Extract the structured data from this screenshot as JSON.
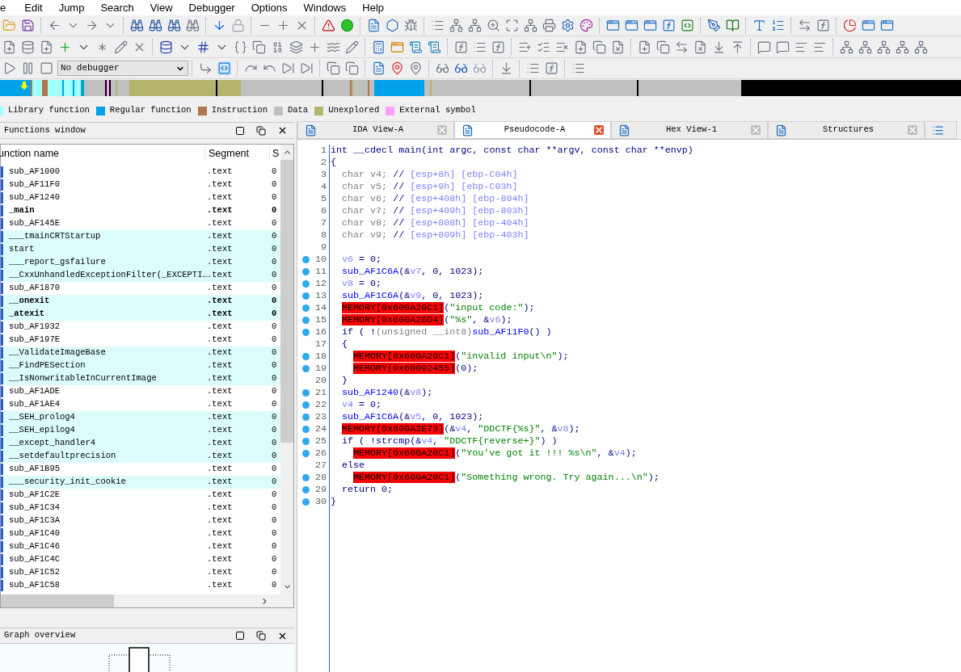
{
  "menu": [
    {
      "label": "e"
    },
    {
      "label": "Edit"
    },
    {
      "label": "Jump"
    },
    {
      "label": "Search"
    },
    {
      "label": "View"
    },
    {
      "label": "Debugger"
    },
    {
      "label": "Options"
    },
    {
      "label": "Windows"
    },
    {
      "label": "Help"
    }
  ],
  "debugger_select": {
    "value": "No debugger"
  },
  "legend": [
    {
      "label": "Library function",
      "color": "#a0ffff"
    },
    {
      "label": "Regular function",
      "color": "#00a2e8"
    },
    {
      "label": "Instruction",
      "color": "#b07850"
    },
    {
      "label": "Data",
      "color": "#c0c0c0"
    },
    {
      "label": "Unexplored",
      "color": "#b4b46c"
    },
    {
      "label": "External symbol",
      "color": "#ffa0ff"
    }
  ],
  "functions_window": {
    "title": "Functions window",
    "columns": [
      "unction name",
      "Segment",
      "S"
    ],
    "rows": [
      {
        "name": "sub_AF1000",
        "segment": ".text",
        "column_3": "0",
        "library": false,
        "bold": false
      },
      {
        "name": "sub_AF11F0",
        "segment": ".text",
        "column_3": "0",
        "library": false,
        "bold": false
      },
      {
        "name": "sub_AF1240",
        "segment": ".text",
        "column_3": "0",
        "library": false,
        "bold": false
      },
      {
        "name": "_main",
        "segment": ".text",
        "column_3": "0",
        "library": false,
        "bold": true
      },
      {
        "name": "sub_AF145E",
        "segment": ".text",
        "column_3": "0",
        "library": false,
        "bold": false
      },
      {
        "name": "___tmainCRTStartup",
        "segment": ".text",
        "column_3": "0",
        "library": true,
        "bold": false
      },
      {
        "name": "start",
        "segment": ".text",
        "column_3": "0",
        "library": true,
        "bold": false
      },
      {
        "name": "___report_gsfailure",
        "segment": ".text",
        "column_3": "0",
        "library": true,
        "bold": false
      },
      {
        "name": "__CxxUnhandledExceptionFilter(_EXCEPTI…",
        "segment": ".text",
        "column_3": "0",
        "library": true,
        "bold": false
      },
      {
        "name": "sub_AF1870",
        "segment": ".text",
        "column_3": "0",
        "library": false,
        "bold": false
      },
      {
        "name": "__onexit",
        "segment": ".text",
        "column_3": "0",
        "library": true,
        "bold": true
      },
      {
        "name": "_atexit",
        "segment": ".text",
        "column_3": "0",
        "library": true,
        "bold": true
      },
      {
        "name": "sub_AF1932",
        "segment": ".text",
        "column_3": "0",
        "library": false,
        "bold": false
      },
      {
        "name": "sub_AF197E",
        "segment": ".text",
        "column_3": "0",
        "library": false,
        "bold": false
      },
      {
        "name": "__ValidateImageBase",
        "segment": ".text",
        "column_3": "0",
        "library": true,
        "bold": false
      },
      {
        "name": "__FindPESection",
        "segment": ".text",
        "column_3": "0",
        "library": true,
        "bold": false
      },
      {
        "name": "__IsNonwritableInCurrentImage",
        "segment": ".text",
        "column_3": "0",
        "library": true,
        "bold": false
      },
      {
        "name": "sub_AF1ADE",
        "segment": ".text",
        "column_3": "0",
        "library": false,
        "bold": false
      },
      {
        "name": "sub_AF1AE4",
        "segment": ".text",
        "column_3": "0",
        "library": false,
        "bold": false
      },
      {
        "name": "__SEH_prolog4",
        "segment": ".text",
        "column_3": "0",
        "library": true,
        "bold": false
      },
      {
        "name": "__SEH_epilog4",
        "segment": ".text",
        "column_3": "0",
        "library": true,
        "bold": false
      },
      {
        "name": "__except_handler4",
        "segment": ".text",
        "column_3": "0",
        "library": true,
        "bold": false
      },
      {
        "name": "__setdefaultprecision",
        "segment": ".text",
        "column_3": "0",
        "library": true,
        "bold": false
      },
      {
        "name": "sub_AF1B95",
        "segment": ".text",
        "column_3": "0",
        "library": false,
        "bold": false
      },
      {
        "name": "___security_init_cookie",
        "segment": ".text",
        "column_3": "0",
        "library": true,
        "bold": false
      },
      {
        "name": "sub_AF1C2E",
        "segment": ".text",
        "column_3": "0",
        "library": false,
        "bold": false
      },
      {
        "name": "sub_AF1C34",
        "segment": ".text",
        "column_3": "0",
        "library": false,
        "bold": false
      },
      {
        "name": "sub_AF1C3A",
        "segment": ".text",
        "column_3": "0",
        "library": false,
        "bold": false
      },
      {
        "name": "sub_AF1C40",
        "segment": ".text",
        "column_3": "0",
        "library": false,
        "bold": false
      },
      {
        "name": "sub_AF1C46",
        "segment": ".text",
        "column_3": "0",
        "library": false,
        "bold": false
      },
      {
        "name": "sub_AF1C4C",
        "segment": ".text",
        "column_3": "0",
        "library": false,
        "bold": false
      },
      {
        "name": "sub_AF1C52",
        "segment": ".text",
        "column_3": "0",
        "library": false,
        "bold": false
      },
      {
        "name": "sub_AF1C58",
        "segment": ".text",
        "column_3": "0",
        "library": false,
        "bold": false
      }
    ]
  },
  "graph_overview": {
    "title": "Graph overview"
  },
  "tabs": [
    {
      "kind": "labeled",
      "label": "IDA View-A",
      "selected": false
    },
    {
      "kind": "labeled",
      "label": "Pseudocode-A",
      "selected": true
    },
    {
      "kind": "labeled",
      "label": "Hex View-1",
      "selected": false
    },
    {
      "kind": "labeled",
      "label": "Structures",
      "selected": false
    },
    {
      "kind": "icon-only",
      "selected": false
    }
  ],
  "code_lines": [
    {
      "n": "1",
      "dot": false,
      "tokens": [
        {
          "kind": "plain",
          "text": "int __cdecl main(int argc, const char **argv, const char **envp)"
        }
      ]
    },
    {
      "n": "2",
      "dot": false,
      "tokens": [
        {
          "kind": "plain",
          "text": "{"
        }
      ],
      "children": [
        {
          "n": "3",
          "dot": false,
          "tokens": [
            {
              "kind": "decl",
              "text": "char v4; "
            },
            {
              "kind": "plain",
              "text": "// "
            },
            {
              "kind": "var",
              "text": "[esp+8h] [ebp-C04h]"
            }
          ]
        },
        {
          "n": "4",
          "dot": false,
          "tokens": [
            {
              "kind": "decl",
              "text": "char v5; "
            },
            {
              "kind": "plain",
              "text": "// "
            },
            {
              "kind": "var",
              "text": "[esp+9h] [ebp-C03h]"
            }
          ]
        },
        {
          "n": "5",
          "dot": false,
          "tokens": [
            {
              "kind": "decl",
              "text": "char v6; "
            },
            {
              "kind": "plain",
              "text": "// "
            },
            {
              "kind": "var",
              "text": "[esp+408h] [ebp-804h]"
            }
          ]
        },
        {
          "n": "6",
          "dot": false,
          "tokens": [
            {
              "kind": "decl",
              "text": "char v7; "
            },
            {
              "kind": "plain",
              "text": "// "
            },
            {
              "kind": "var",
              "text": "[esp+409h] [ebp-803h]"
            }
          ]
        },
        {
          "n": "7",
          "dot": false,
          "tokens": [
            {
              "kind": "decl",
              "text": "char v8; "
            },
            {
              "kind": "plain",
              "text": "// "
            },
            {
              "kind": "var",
              "text": "[esp+808h] [ebp-404h]"
            }
          ]
        },
        {
          "n": "8",
          "dot": false,
          "tokens": [
            {
              "kind": "decl",
              "text": "char v9; "
            },
            {
              "kind": "plain",
              "text": "// "
            },
            {
              "kind": "var",
              "text": "[esp+809h] [ebp-403h]"
            }
          ]
        },
        {
          "n": "9",
          "dot": false
        },
        {
          "n": "10",
          "dot": true,
          "tokens": [
            {
              "kind": "var",
              "text": "v6"
            },
            {
              "kind": "plain",
              "text": " = 0;"
            }
          ]
        },
        {
          "n": "11",
          "dot": true,
          "tokens": [
            {
              "kind": "func",
              "text": "sub_AF1C6A"
            },
            {
              "kind": "plain",
              "text": "(&"
            },
            {
              "kind": "var",
              "text": "v7"
            },
            {
              "kind": "plain",
              "text": ", 0, 1023);"
            }
          ]
        },
        {
          "n": "12",
          "dot": true,
          "tokens": [
            {
              "kind": "var",
              "text": "v8"
            },
            {
              "kind": "plain",
              "text": " = 0;"
            }
          ]
        },
        {
          "n": "13",
          "dot": true,
          "tokens": [
            {
              "kind": "func",
              "text": "sub_AF1C6A"
            },
            {
              "kind": "plain",
              "text": "(&"
            },
            {
              "kind": "var",
              "text": "v9"
            },
            {
              "kind": "plain",
              "text": ", 0, 1023);"
            }
          ]
        },
        {
          "n": "14",
          "dot": true,
          "tokens": [
            {
              "kind": "mem",
              "text": "MEMORY[0x600A20C1]"
            },
            {
              "kind": "plain",
              "text": "("
            },
            {
              "kind": "str",
              "text": "\"input code:\""
            },
            {
              "kind": "plain",
              "text": ");"
            }
          ]
        },
        {
          "n": "15",
          "dot": true,
          "tokens": [
            {
              "kind": "mem",
              "text": "MEMORY[0x600A26D4]"
            },
            {
              "kind": "plain",
              "text": "("
            },
            {
              "kind": "str",
              "text": "\"%s\""
            },
            {
              "kind": "plain",
              "text": ", &"
            },
            {
              "kind": "var",
              "text": "v6"
            },
            {
              "kind": "plain",
              "text": ");"
            }
          ]
        },
        {
          "n": "16",
          "dot": true,
          "tokens": [
            {
              "kind": "plain",
              "text": "if ( !"
            },
            {
              "kind": "decl",
              "text": "(unsigned __int8)"
            },
            {
              "kind": "func",
              "text": "sub_AF11F0"
            },
            {
              "kind": "plain",
              "text": "() )"
            }
          ]
        },
        {
          "n": "17",
          "dot": false,
          "tokens": [
            {
              "kind": "plain",
              "text": "{"
            }
          ],
          "children": [
            {
              "n": "18",
              "dot": true,
              "tokens": [
                {
                  "kind": "mem",
                  "text": "MEMORY[0x600A20C1]"
                },
                {
                  "kind": "plain",
                  "text": "("
                },
                {
                  "kind": "str",
                  "text": "\"invalid input\\n\""
                },
                {
                  "kind": "plain",
                  "text": ");"
                }
              ]
            },
            {
              "n": "19",
              "dot": true,
              "tokens": [
                {
                  "kind": "mem",
                  "text": "MEMORY[0x60092455]"
                },
                {
                  "kind": "plain",
                  "text": "(0);"
                }
              ]
            }
          ]
        },
        {
          "n": "20",
          "dot": false,
          "tokens": [
            {
              "kind": "plain",
              "text": "}"
            }
          ]
        },
        {
          "n": "21",
          "dot": true,
          "tokens": [
            {
              "kind": "func",
              "text": "sub_AF1240"
            },
            {
              "kind": "plain",
              "text": "(&"
            },
            {
              "kind": "var",
              "text": "v8"
            },
            {
              "kind": "plain",
              "text": ");"
            }
          ]
        },
        {
          "n": "22",
          "dot": true,
          "tokens": [
            {
              "kind": "var",
              "text": "v4"
            },
            {
              "kind": "plain",
              "text": " = 0;"
            }
          ]
        },
        {
          "n": "23",
          "dot": true,
          "tokens": [
            {
              "kind": "func",
              "text": "sub_AF1C6A"
            },
            {
              "kind": "plain",
              "text": "(&"
            },
            {
              "kind": "var",
              "text": "v5"
            },
            {
              "kind": "plain",
              "text": ", 0, 1023);"
            }
          ]
        },
        {
          "n": "24",
          "dot": true,
          "tokens": [
            {
              "kind": "mem",
              "text": "MEMORY[0x600A2E73]"
            },
            {
              "kind": "plain",
              "text": "(&"
            },
            {
              "kind": "var",
              "text": "v4"
            },
            {
              "kind": "plain",
              "text": ", "
            },
            {
              "kind": "str",
              "text": "\"DDCTF{%s}\""
            },
            {
              "kind": "plain",
              "text": ", &"
            },
            {
              "kind": "var",
              "text": "v8"
            },
            {
              "kind": "plain",
              "text": ");"
            }
          ]
        },
        {
          "n": "25",
          "dot": true,
          "tokens": [
            {
              "kind": "plain",
              "text": "if ( !strcmp(&"
            },
            {
              "kind": "var",
              "text": "v4"
            },
            {
              "kind": "plain",
              "text": ", "
            },
            {
              "kind": "str",
              "text": "\"DDCTF{reverse+}\""
            },
            {
              "kind": "plain",
              "text": ") )"
            }
          ],
          "children": [
            {
              "n": "26",
              "dot": true,
              "tokens": [
                {
                  "kind": "mem",
                  "text": "MEMORY[0x600A20C1]"
                },
                {
                  "kind": "plain",
                  "text": "("
                },
                {
                  "kind": "str",
                  "text": "\"You've got it !!! %s\\n\""
                },
                {
                  "kind": "plain",
                  "text": ", &"
                },
                {
                  "kind": "var",
                  "text": "v4"
                },
                {
                  "kind": "plain",
                  "text": ");"
                }
              ]
            }
          ]
        },
        {
          "n": "27",
          "dot": false,
          "tokens": [
            {
              "kind": "plain",
              "text": "else"
            }
          ],
          "children": [
            {
              "n": "28",
              "dot": true,
              "tokens": [
                {
                  "kind": "mem",
                  "text": "MEMORY[0x600A20C1]"
                },
                {
                  "kind": "plain",
                  "text": "("
                },
                {
                  "kind": "str",
                  "text": "\"Something wrong. Try again...\\n\""
                },
                {
                  "kind": "plain",
                  "text": ");"
                }
              ]
            }
          ]
        },
        {
          "n": "29",
          "dot": true,
          "tokens": [
            {
              "kind": "plain",
              "text": "return 0;"
            }
          ]
        }
      ]
    },
    {
      "n": "30",
      "dot": true,
      "tokens": [
        {
          "kind": "plain",
          "text": "}"
        }
      ]
    }
  ]
}
